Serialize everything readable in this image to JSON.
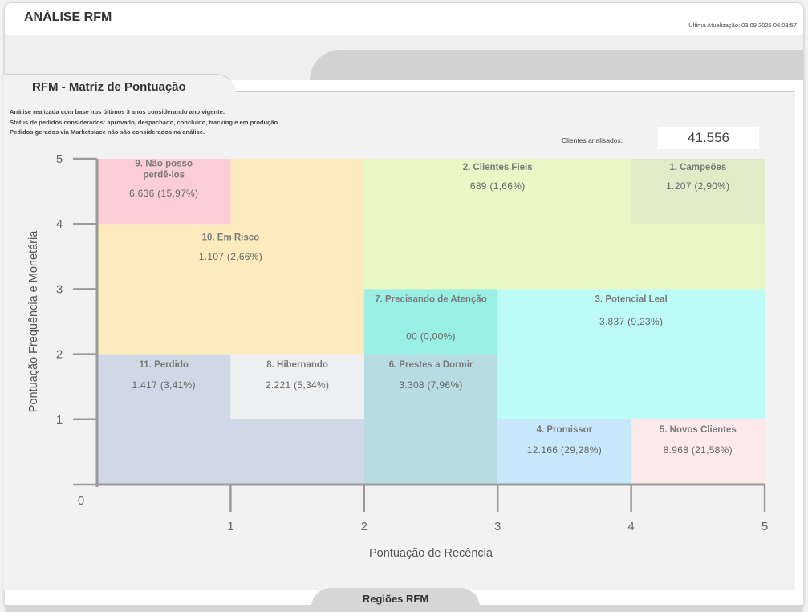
{
  "header": {
    "title": "ANÁLISE RFM",
    "update_label": "Última Atualização:",
    "update_value": "03 09 2026 06:03:57"
  },
  "section": {
    "title": "RFM - Matriz de Pontuação",
    "notes": [
      "Análise realizada com base nos últimos 3 anos considerando ano vigente.",
      "Status de pedidos considerados: aprovado, despachado, concluído, tracking e em produção.",
      "Pedidos gerados via Marketplace não são considerados na análise."
    ],
    "clients_label": "Clientes analisados:",
    "clients_value": "41.556"
  },
  "bottom_tab": "Regiões RFM",
  "chart_data": {
    "type": "heatmap",
    "xlabel": "Pontuação de Recência",
    "ylabel": "Pontuação Frequência e Monetária",
    "xlim": [
      0,
      5
    ],
    "ylim": [
      0,
      5
    ],
    "x_ticks": [
      "1",
      "2",
      "3",
      "4",
      "5"
    ],
    "y_ticks": [
      "1",
      "2",
      "3",
      "4",
      "5"
    ],
    "origin_label": "0",
    "segments": [
      {
        "name": "9. Não posso perdê-los",
        "value": "6.636 (15,97%)",
        "x0": 0,
        "x1": 1,
        "y0": 4,
        "y1": 5,
        "color": "#fbcdd5"
      },
      {
        "name": "10. Em Risco",
        "value": "1.107 (2,66%)",
        "x0": 0,
        "x1": 2,
        "y0": 2,
        "y1": 4,
        "ext": {
          "x0": 1,
          "x1": 2,
          "y0": 4,
          "y1": 5
        },
        "color": "#feebbd"
      },
      {
        "name": "2. Clientes Fieis",
        "value": "689 (1,66%)",
        "x0": 2,
        "x1": 5,
        "y0": 3,
        "y1": 5,
        "color": "#e7f7c5"
      },
      {
        "name": "1. Campeões",
        "value": "1.207 (2,90%)",
        "x0": 4,
        "x1": 5,
        "y0": 4,
        "y1": 5,
        "color": "#e1ebc8"
      },
      {
        "name": "7. Precisando de Atenção",
        "value": "00 (0,00%)",
        "x0": 2,
        "x1": 3,
        "y0": 2,
        "y1": 3,
        "color": "#99efe3"
      },
      {
        "name": "3. Potencial Leal",
        "value": "3.837 (9,23%)",
        "x0": 3,
        "x1": 5,
        "y0": 1,
        "y1": 3,
        "color": "#bdfcf6"
      },
      {
        "name": "11. Perdido",
        "value": "1.417 (3,41%)",
        "x0": 0,
        "x1": 1,
        "y0": 0,
        "y1": 2,
        "color": "#cfd8e4"
      },
      {
        "name": "8. Hibernando",
        "value": "2.221 (5,34%)",
        "x0": 1,
        "x1": 2,
        "y0": 1,
        "y1": 2,
        "color": "#eeeff1"
      },
      {
        "name": "6. Prestes a Dormir",
        "value": "3.308 (7,96%)",
        "x0": 2,
        "x1": 3,
        "y0": 0,
        "y1": 2,
        "color": "#b7dde3"
      },
      {
        "name": "4. Promissor",
        "value": "12.166 (29,28%)",
        "x0": 3,
        "x1": 4,
        "y0": 0,
        "y1": 1,
        "color": "#c7e7fb"
      },
      {
        "name": "5. Novos Clientes",
        "value": "8.968 (21,58%)",
        "x0": 4,
        "x1": 5,
        "y0": 0,
        "y1": 1,
        "color": "#fbeae9"
      }
    ],
    "extra_fill": {
      "x0": 1,
      "x1": 2,
      "y0": 0,
      "y1": 1,
      "color": "#cfd8e4"
    }
  },
  "colors": {
    "axis": "#9a9a9a",
    "label_text": "#666666",
    "segment_title": "#7a7a7a"
  }
}
